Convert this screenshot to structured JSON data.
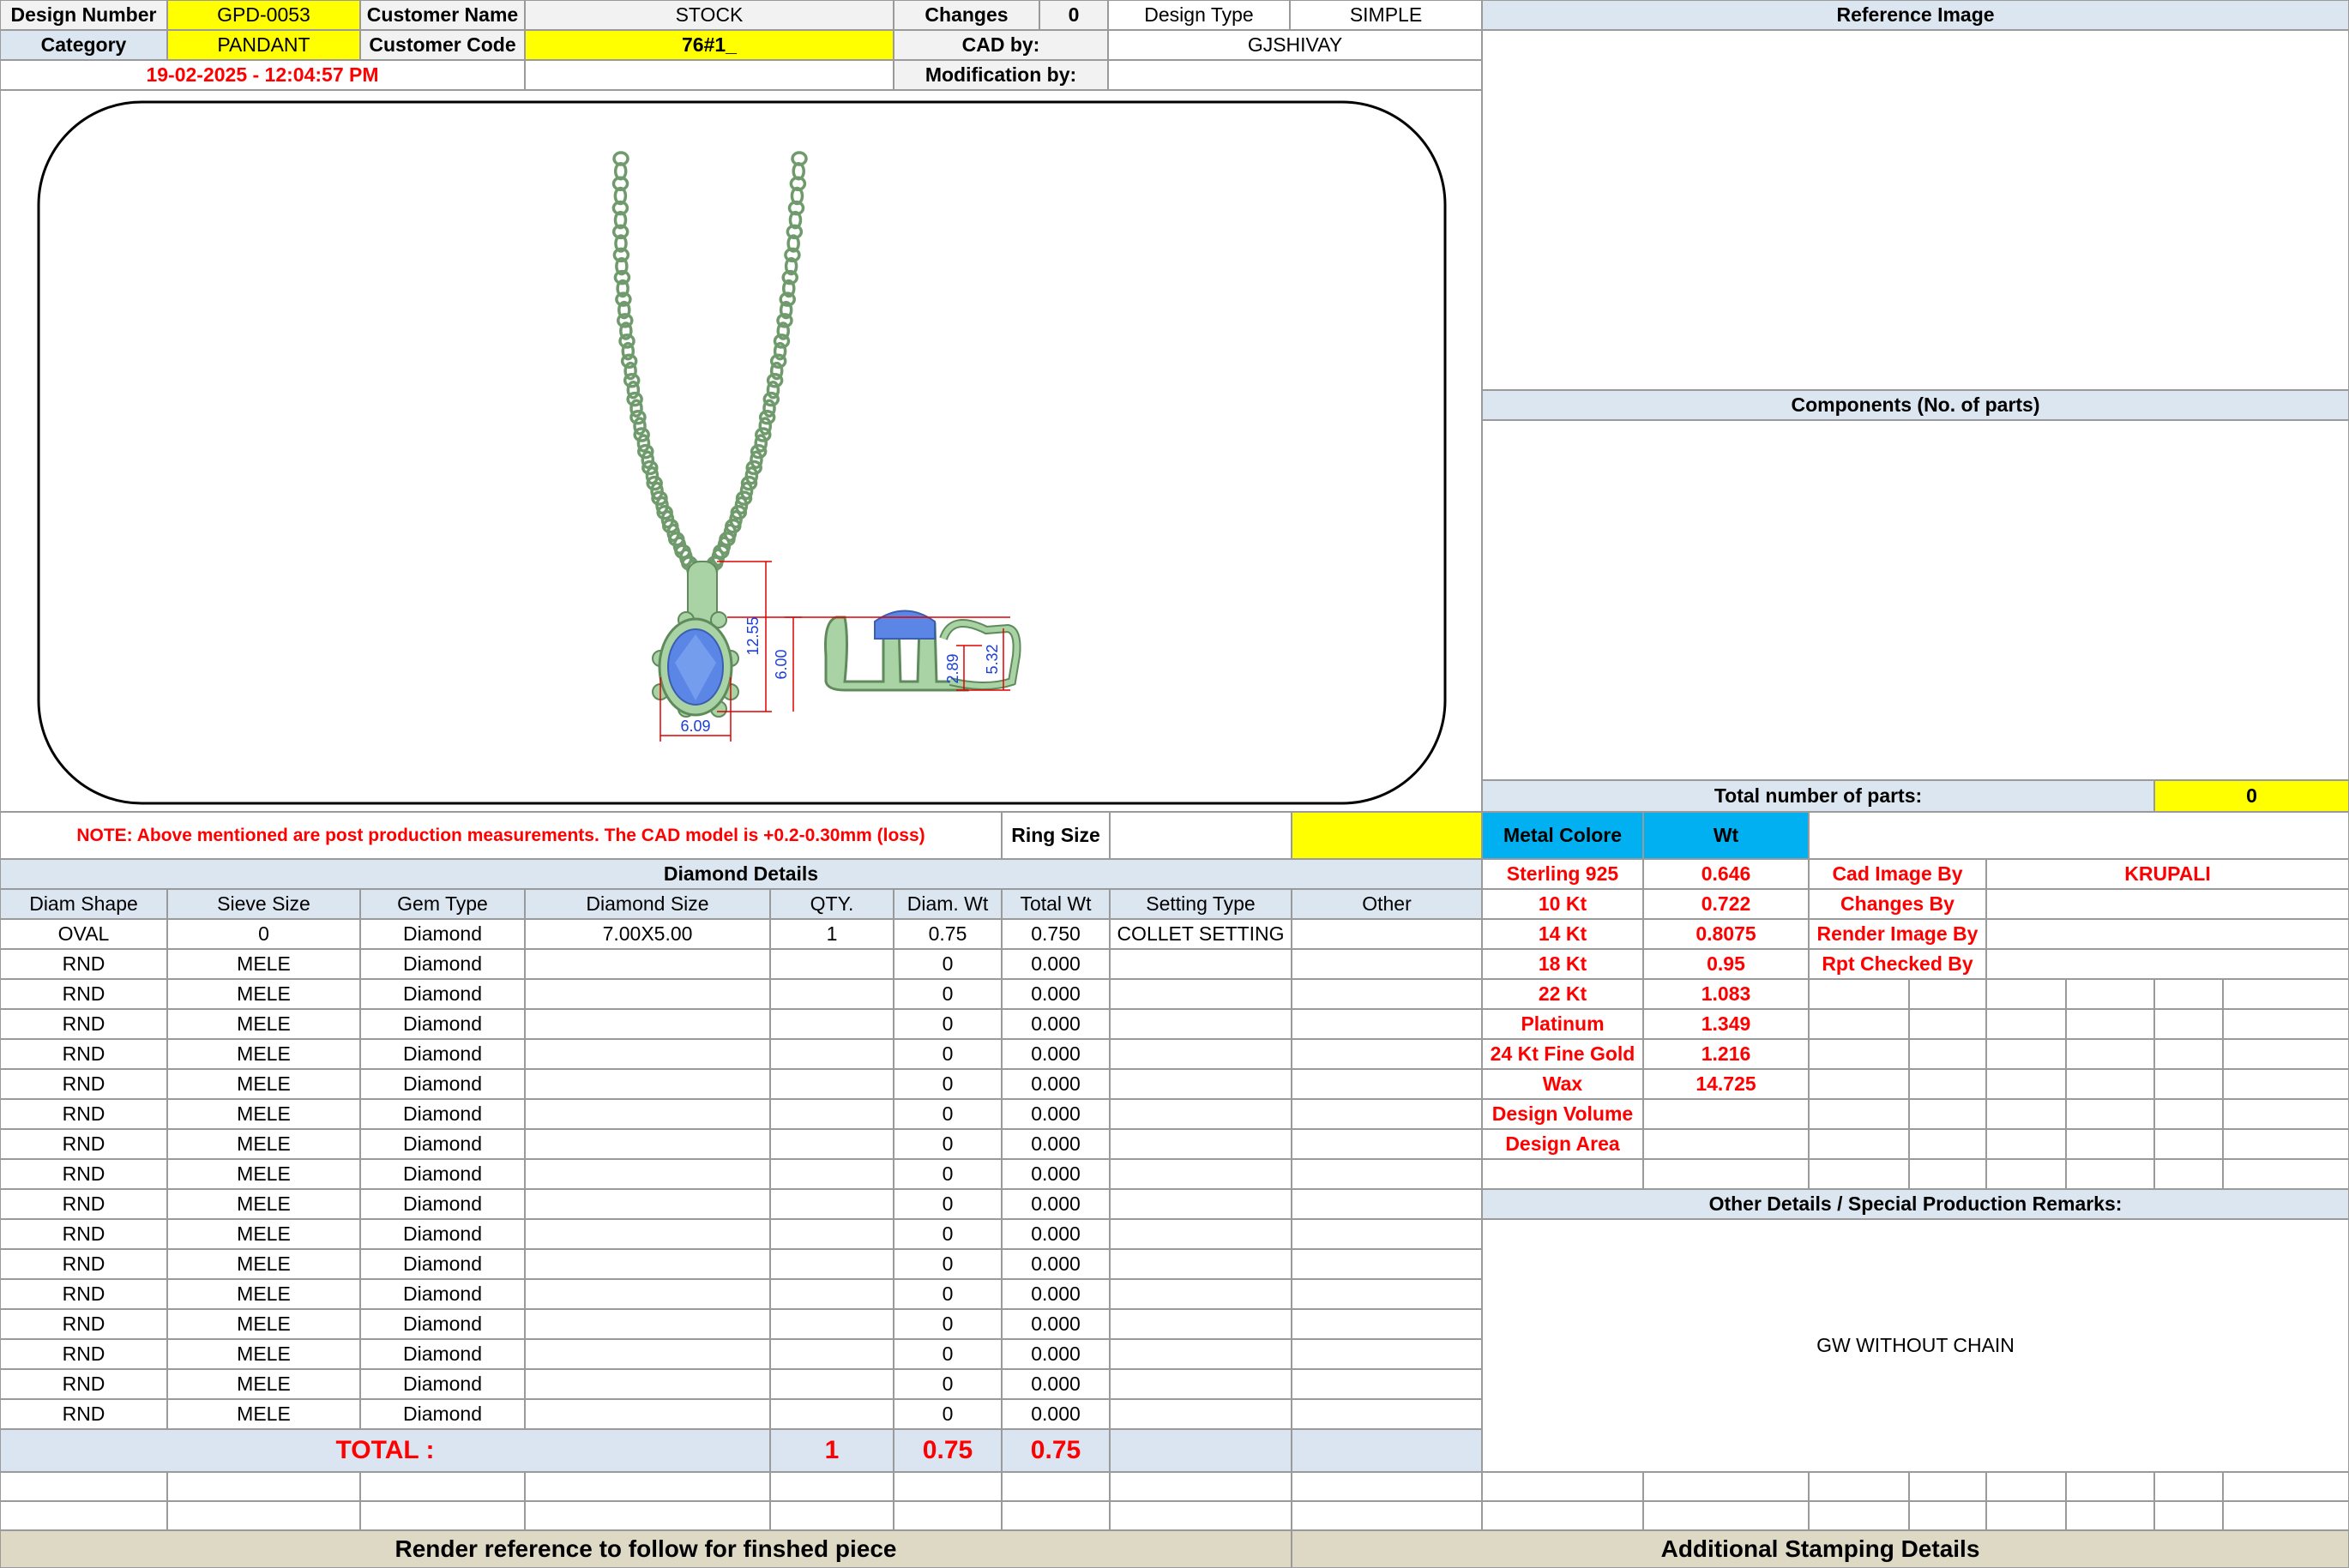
{
  "header": {
    "design_number_label": "Design Number",
    "design_number": "GPD-0053",
    "customer_name_label": "Customer Name",
    "customer_name": "STOCK",
    "changes_label": "Changes",
    "changes": "0",
    "design_type_label": "Design Type",
    "design_type": "SIMPLE",
    "category_label": "Category",
    "category": "PANDANT",
    "customer_code_label": "Customer Code",
    "customer_code": "76#1_",
    "cad_by_label": "CAD by:",
    "cad_by": "GJSHIVAY",
    "timestamp": "19-02-2025 - 12:04:57 PM",
    "modification_by_label": "Modification by:"
  },
  "drawing": {
    "dims": {
      "height": "12.55",
      "stone_height": "6.00",
      "width": "6.09",
      "side_small": "2.89",
      "side_total": "5.32"
    },
    "colors": {
      "metal": "#a9d3a4",
      "stone": "#5b86e5",
      "dimension": "#e00000"
    }
  },
  "note": "NOTE: Above mentioned are post production measurements. The CAD model is +0.2-0.30mm (loss)",
  "ring_size_label": "Ring Size",
  "diamond": {
    "title": "Diamond Details",
    "headers": [
      "Diam Shape",
      "Sieve Size",
      "Gem Type",
      "Diamond Size",
      "QTY.",
      "Diam. Wt",
      "Total Wt",
      "Setting Type",
      "Other"
    ],
    "rows": [
      [
        "OVAL",
        "0",
        "Diamond",
        "7.00X5.00",
        "1",
        "0.75",
        "0.750",
        "COLLET SETTING",
        ""
      ],
      [
        "RND",
        "MELE",
        "Diamond",
        "",
        "",
        "0",
        "0.000",
        "",
        ""
      ],
      [
        "RND",
        "MELE",
        "Diamond",
        "",
        "",
        "0",
        "0.000",
        "",
        ""
      ],
      [
        "RND",
        "MELE",
        "Diamond",
        "",
        "",
        "0",
        "0.000",
        "",
        ""
      ],
      [
        "RND",
        "MELE",
        "Diamond",
        "",
        "",
        "0",
        "0.000",
        "",
        ""
      ],
      [
        "RND",
        "MELE",
        "Diamond",
        "",
        "",
        "0",
        "0.000",
        "",
        ""
      ],
      [
        "RND",
        "MELE",
        "Diamond",
        "",
        "",
        "0",
        "0.000",
        "",
        ""
      ],
      [
        "RND",
        "MELE",
        "Diamond",
        "",
        "",
        "0",
        "0.000",
        "",
        ""
      ],
      [
        "RND",
        "MELE",
        "Diamond",
        "",
        "",
        "0",
        "0.000",
        "",
        ""
      ],
      [
        "RND",
        "MELE",
        "Diamond",
        "",
        "",
        "0",
        "0.000",
        "",
        ""
      ],
      [
        "RND",
        "MELE",
        "Diamond",
        "",
        "",
        "0",
        "0.000",
        "",
        ""
      ],
      [
        "RND",
        "MELE",
        "Diamond",
        "",
        "",
        "0",
        "0.000",
        "",
        ""
      ],
      [
        "RND",
        "MELE",
        "Diamond",
        "",
        "",
        "0",
        "0.000",
        "",
        ""
      ],
      [
        "RND",
        "MELE",
        "Diamond",
        "",
        "",
        "0",
        "0.000",
        "",
        ""
      ],
      [
        "RND",
        "MELE",
        "Diamond",
        "",
        "",
        "0",
        "0.000",
        "",
        ""
      ],
      [
        "RND",
        "MELE",
        "Diamond",
        "",
        "",
        "0",
        "0.000",
        "",
        ""
      ],
      [
        "RND",
        "MELE",
        "Diamond",
        "",
        "",
        "0",
        "0.000",
        "",
        ""
      ]
    ],
    "total_label": "TOTAL :",
    "total_qty": "1",
    "total_diam_wt": "0.75",
    "total_wt": "0.75"
  },
  "right": {
    "reference_image_label": "Reference Image",
    "components_label": "Components (No. of parts)",
    "total_parts_label": "Total number of parts:",
    "total_parts": "0",
    "metal_colore_label": "Metal Colore",
    "wt_label": "Wt",
    "metals": [
      {
        "name": "Sterling 925",
        "wt": "0.646"
      },
      {
        "name": "10 Kt",
        "wt": "0.722"
      },
      {
        "name": "14 Kt",
        "wt": "0.8075"
      },
      {
        "name": "18 Kt",
        "wt": "0.95"
      },
      {
        "name": "22 Kt",
        "wt": "1.083"
      },
      {
        "name": "Platinum",
        "wt": "1.349"
      },
      {
        "name": "24 Kt Fine Gold",
        "wt": "1.216"
      },
      {
        "name": "Wax",
        "wt": "14.725"
      },
      {
        "name": "Design Volume",
        "wt": ""
      },
      {
        "name": "Design Area",
        "wt": ""
      }
    ],
    "credits": [
      {
        "label": "Cad Image By",
        "value": "KRUPALI"
      },
      {
        "label": "Changes By",
        "value": ""
      },
      {
        "label": "Render Image By",
        "value": ""
      },
      {
        "label": "Rpt Checked By",
        "value": ""
      }
    ],
    "other_details_label": "Other Details / Special Production Remarks:",
    "remarks": "GW WITHOUT CHAIN"
  },
  "footer": {
    "render_reference": "Render reference to follow for finshed piece",
    "stamping": "Additional Stamping Details"
  }
}
